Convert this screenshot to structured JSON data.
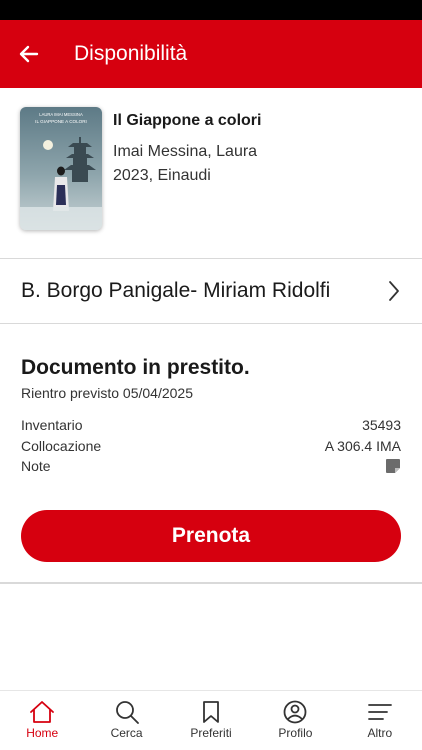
{
  "app_bar": {
    "title": "Disponibilità",
    "back_icon": "arrow-left-icon"
  },
  "book": {
    "title": "Il Giappone a colori",
    "author": "Imai Messina, Laura",
    "year_publisher": "2023, Einaudi",
    "cover": {
      "author_caption": "LAURA IMAI MESSINA",
      "title_caption": "IL GIAPPONE A COLORI"
    }
  },
  "library": {
    "name": "B. Borgo Panigale- Miriam Ridolfi",
    "chevron_icon": "chevron-right-icon"
  },
  "loan": {
    "status": "Documento in prestito.",
    "return_text": "Rientro previsto 05/04/2025",
    "details": [
      {
        "label": "Inventario",
        "value": "35493"
      },
      {
        "label": "Collocazione",
        "value": "A 306.4 IMA"
      },
      {
        "label": "Note",
        "icon": "note-icon"
      }
    ],
    "button_label": "Prenota"
  },
  "tabbar": {
    "items": [
      {
        "label": "Home",
        "icon": "home-icon",
        "active": true
      },
      {
        "label": "Cerca",
        "icon": "search-icon",
        "active": false
      },
      {
        "label": "Preferiti",
        "icon": "bookmark-icon",
        "active": false
      },
      {
        "label": "Profilo",
        "icon": "profile-icon",
        "active": false
      },
      {
        "label": "Altro",
        "icon": "menu-icon",
        "active": false
      }
    ]
  },
  "colors": {
    "accent": "#d6000f",
    "text": "#1a1a1a",
    "divider": "#d9d9d9"
  }
}
